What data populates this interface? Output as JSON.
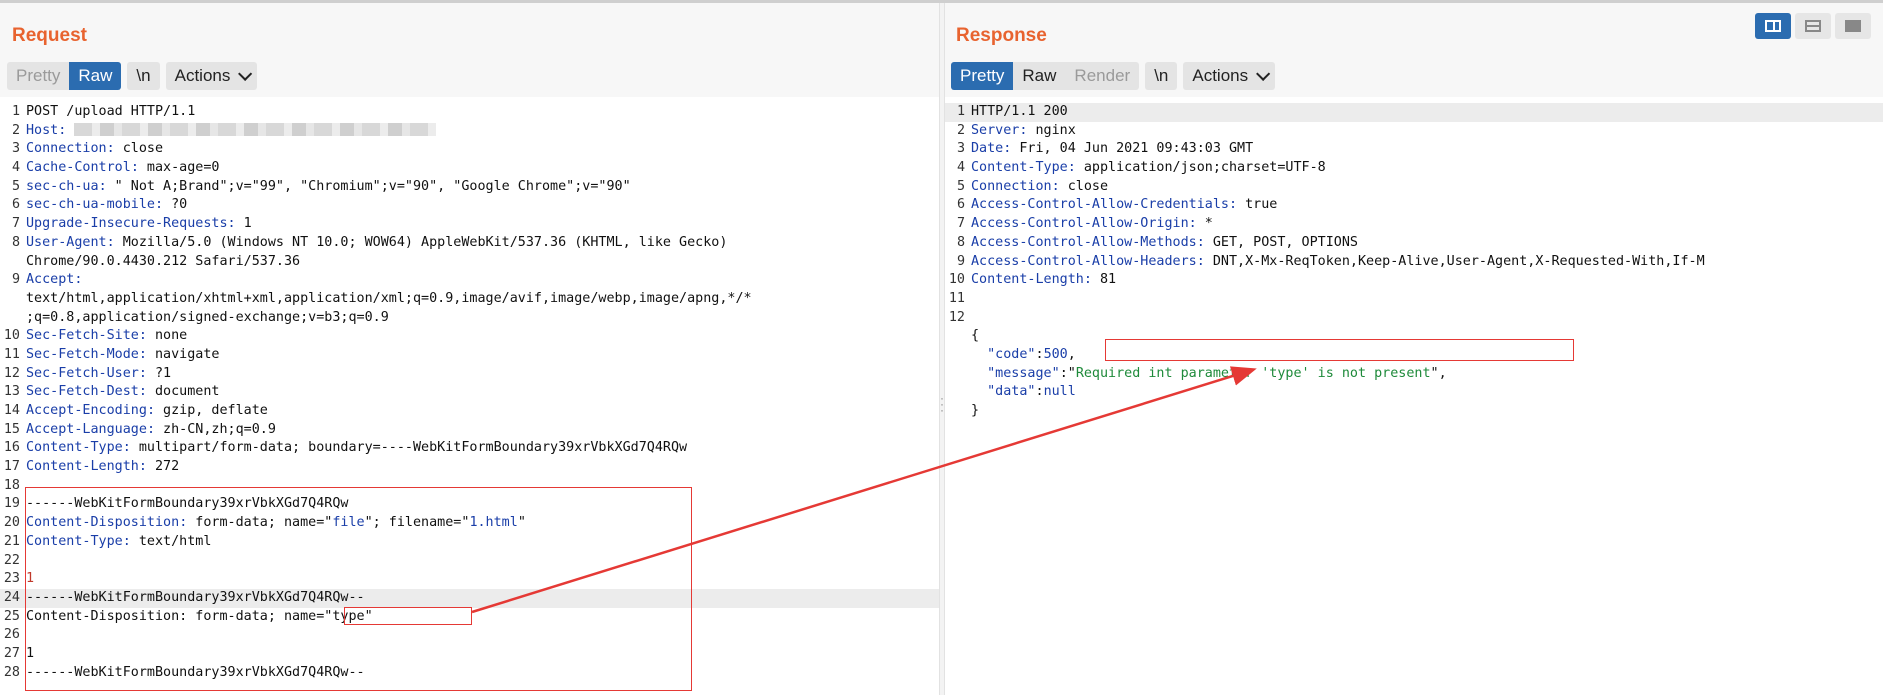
{
  "request": {
    "title": "Request",
    "tabs": {
      "pretty": "Pretty",
      "raw": "Raw",
      "newline": "\\n",
      "actions": "Actions"
    },
    "lines": [
      {
        "n": "1",
        "name": "",
        "sep": "",
        "value": "POST /upload HTTP/1.1"
      },
      {
        "n": "2",
        "name": "Host",
        "sep": ":",
        "value": ""
      },
      {
        "n": "3",
        "name": "Connection",
        "sep": ":",
        "value": " close"
      },
      {
        "n": "4",
        "name": "Cache-Control",
        "sep": ":",
        "value": " max-age=0"
      },
      {
        "n": "5",
        "name": "sec-ch-ua",
        "sep": ":",
        "value": " \" Not A;Brand\";v=\"99\", \"Chromium\";v=\"90\", \"Google Chrome\";v=\"90\""
      },
      {
        "n": "6",
        "name": "sec-ch-ua-mobile",
        "sep": ":",
        "value": " ?0"
      },
      {
        "n": "7",
        "name": "Upgrade-Insecure-Requests",
        "sep": ":",
        "value": " 1"
      },
      {
        "n": "8",
        "name": "User-Agent",
        "sep": ":",
        "value": " Mozilla/5.0 (Windows NT 10.0; WOW64) AppleWebKit/537.36 (KHTML, like Gecko)"
      },
      {
        "n": "",
        "name": "",
        "sep": "",
        "value": "Chrome/90.0.4430.212 Safari/537.36"
      },
      {
        "n": "9",
        "name": "Accept",
        "sep": ":",
        "value": ""
      },
      {
        "n": "",
        "name": "",
        "sep": "",
        "value": "text/html,application/xhtml+xml,application/xml;q=0.9,image/avif,image/webp,image/apng,*/*"
      },
      {
        "n": "",
        "name": "",
        "sep": "",
        "value": ";q=0.8,application/signed-exchange;v=b3;q=0.9"
      },
      {
        "n": "10",
        "name": "Sec-Fetch-Site",
        "sep": ":",
        "value": " none"
      },
      {
        "n": "11",
        "name": "Sec-Fetch-Mode",
        "sep": ":",
        "value": " navigate"
      },
      {
        "n": "12",
        "name": "Sec-Fetch-User",
        "sep": ":",
        "value": " ?1"
      },
      {
        "n": "13",
        "name": "Sec-Fetch-Dest",
        "sep": ":",
        "value": " document"
      },
      {
        "n": "14",
        "name": "Accept-Encoding",
        "sep": ":",
        "value": " gzip, deflate"
      },
      {
        "n": "15",
        "name": "Accept-Language",
        "sep": ":",
        "value": " zh-CN,zh;q=0.9"
      },
      {
        "n": "16",
        "name": "Content-Type",
        "sep": ":",
        "value": " multipart/form-data; boundary=----WebKitFormBoundary39xrVbkXGd7Q4RQw"
      },
      {
        "n": "17",
        "name": "Content-Length",
        "sep": ":",
        "value": " 272"
      },
      {
        "n": "18",
        "name": "",
        "sep": "",
        "value": ""
      },
      {
        "n": "19",
        "name": "",
        "sep": "",
        "value": "------WebKitFormBoundary39xrVbkXGd7Q4RQw"
      },
      {
        "n": "20",
        "name": "Content-Disposition",
        "sep": ":",
        "value": " form-data; name=\"",
        "extra": [
          {
            "t": "file",
            "c": "str"
          },
          {
            "t": "\"; filename=\"",
            "c": ""
          },
          {
            "t": "1.html",
            "c": "str"
          },
          {
            "t": "\"",
            "c": ""
          }
        ]
      },
      {
        "n": "21",
        "name": "Content-Type",
        "sep": ":",
        "value": " text/html"
      },
      {
        "n": "22",
        "name": "",
        "sep": "",
        "value": ""
      },
      {
        "n": "23",
        "name": "",
        "sep": "",
        "value": "1",
        "cls": "red"
      },
      {
        "n": "24",
        "name": "",
        "sep": "",
        "value": "------WebKitFormBoundary39xrVbkXGd7Q4RQw--",
        "hl": true
      },
      {
        "n": "25",
        "name": "",
        "sep": "",
        "value": "Content-Disposition: form-data; name=\"type\""
      },
      {
        "n": "26",
        "name": "",
        "sep": "",
        "value": ""
      },
      {
        "n": "27",
        "name": "",
        "sep": "",
        "value": "1"
      },
      {
        "n": "28",
        "name": "",
        "sep": "",
        "value": "------WebKitFormBoundary39xrVbkXGd7Q4RQw--"
      }
    ]
  },
  "response": {
    "title": "Response",
    "tabs": {
      "pretty": "Pretty",
      "raw": "Raw",
      "render": "Render",
      "newline": "\\n",
      "actions": "Actions"
    },
    "lines": [
      {
        "n": "1",
        "name": "",
        "sep": "",
        "value": "HTTP/1.1 200",
        "hl": true
      },
      {
        "n": "2",
        "name": "Server",
        "sep": ":",
        "value": " nginx"
      },
      {
        "n": "3",
        "name": "Date",
        "sep": ":",
        "value": " Fri, 04 Jun 2021 09:43:03 GMT"
      },
      {
        "n": "4",
        "name": "Content-Type",
        "sep": ":",
        "value": " application/json;charset=UTF-8"
      },
      {
        "n": "5",
        "name": "Connection",
        "sep": ":",
        "value": " close"
      },
      {
        "n": "6",
        "name": "Access-Control-Allow-Credentials",
        "sep": ":",
        "value": " true"
      },
      {
        "n": "7",
        "name": "Access-Control-Allow-Origin",
        "sep": ":",
        "value": " *"
      },
      {
        "n": "8",
        "name": "Access-Control-Allow-Methods",
        "sep": ":",
        "value": " GET, POST, OPTIONS"
      },
      {
        "n": "9",
        "name": "Access-Control-Allow-Headers",
        "sep": ":",
        "value": " DNT,X-Mx-ReqToken,Keep-Alive,User-Agent,X-Requested-With,If-M"
      },
      {
        "n": "10",
        "name": "Content-Length",
        "sep": ":",
        "value": " 81"
      },
      {
        "n": "11",
        "name": "",
        "sep": "",
        "value": ""
      },
      {
        "n": "12",
        "name": "",
        "sep": "",
        "value": ""
      },
      {
        "n": "",
        "name": "",
        "sep": "",
        "value": "{"
      },
      {
        "n": "",
        "name": "",
        "sep": "",
        "value": "",
        "json": [
          {
            "t": "  \"code\"",
            "c": "str"
          },
          {
            "t": ":",
            "c": ""
          },
          {
            "t": "500",
            "c": "str"
          },
          {
            "t": ",",
            "c": ""
          }
        ]
      },
      {
        "n": "",
        "name": "",
        "sep": "",
        "value": "",
        "json": [
          {
            "t": "  \"message\"",
            "c": "str"
          },
          {
            "t": ":\"",
            "c": ""
          },
          {
            "t": "Required int parameter 'type' is not present",
            "c": "green"
          },
          {
            "t": "\",",
            "c": ""
          }
        ]
      },
      {
        "n": "",
        "name": "",
        "sep": "",
        "value": "",
        "json": [
          {
            "t": "  \"data\"",
            "c": "str"
          },
          {
            "t": ":",
            "c": ""
          },
          {
            "t": "null",
            "c": "str"
          }
        ]
      },
      {
        "n": "",
        "name": "",
        "sep": "",
        "value": "}"
      }
    ]
  },
  "layout_toggle": {
    "icons": [
      "split-view-icon",
      "rows-view-icon",
      "full-view-icon"
    ]
  },
  "colors": {
    "title": "#e8632f",
    "accent": "#2b6cb0",
    "header_name": "#1a3ea8",
    "annotation": "#e53935"
  }
}
